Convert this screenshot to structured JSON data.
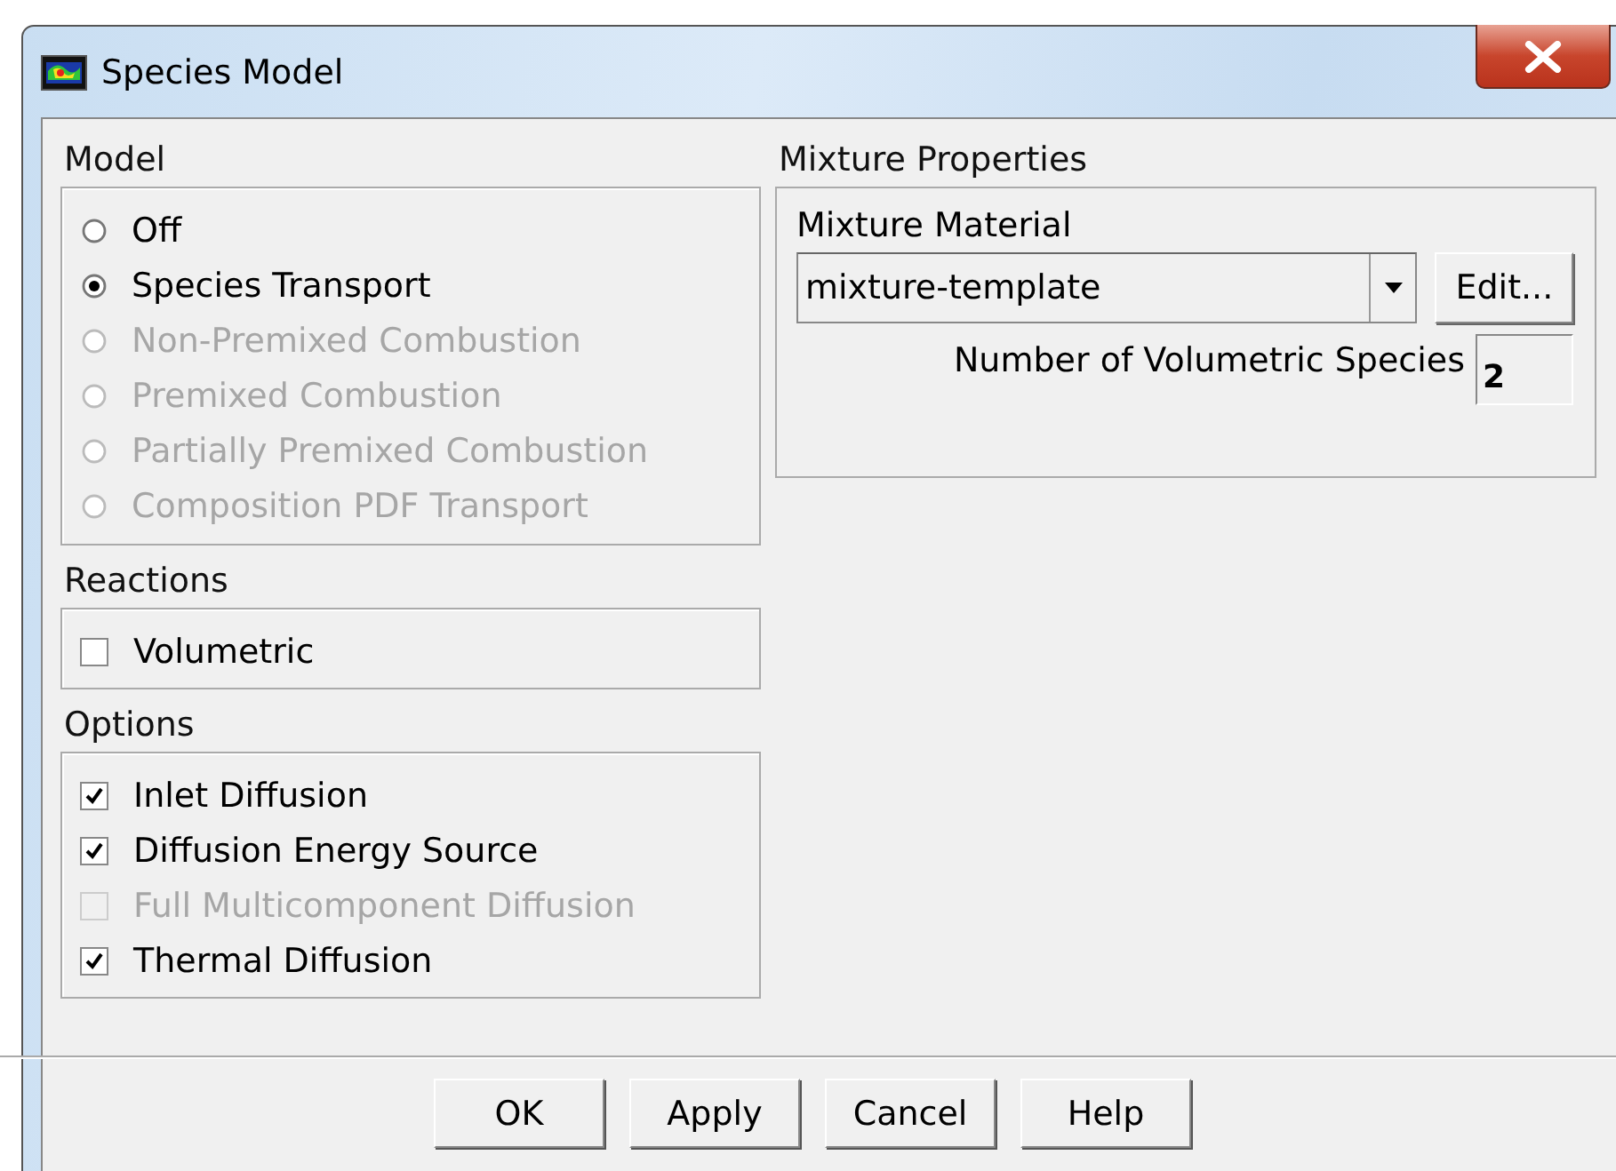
{
  "window": {
    "title": "Species Model"
  },
  "model": {
    "heading": "Model",
    "options": [
      {
        "label": "Off",
        "selected": false,
        "disabled": false
      },
      {
        "label": "Species Transport",
        "selected": true,
        "disabled": false
      },
      {
        "label": "Non-Premixed Combustion",
        "selected": false,
        "disabled": true
      },
      {
        "label": "Premixed Combustion",
        "selected": false,
        "disabled": true
      },
      {
        "label": "Partially Premixed Combustion",
        "selected": false,
        "disabled": true
      },
      {
        "label": "Composition PDF Transport",
        "selected": false,
        "disabled": true
      }
    ]
  },
  "reactions": {
    "heading": "Reactions",
    "options": [
      {
        "label": "Volumetric",
        "checked": false,
        "disabled": false
      }
    ]
  },
  "options": {
    "heading": "Options",
    "options": [
      {
        "label": "Inlet Diffusion",
        "checked": true,
        "disabled": false
      },
      {
        "label": "Diffusion Energy Source",
        "checked": true,
        "disabled": false
      },
      {
        "label": "Full Multicomponent Diffusion",
        "checked": false,
        "disabled": true
      },
      {
        "label": "Thermal Diffusion",
        "checked": true,
        "disabled": false
      }
    ]
  },
  "mixture": {
    "heading": "Mixture Properties",
    "material_label": "Mixture Material",
    "material": "mixture-template",
    "edit_button": "Edit...",
    "species_label": "Number of Volumetric Species",
    "species_count": "2"
  },
  "buttons": [
    "OK",
    "Apply",
    "Cancel",
    "Help"
  ]
}
